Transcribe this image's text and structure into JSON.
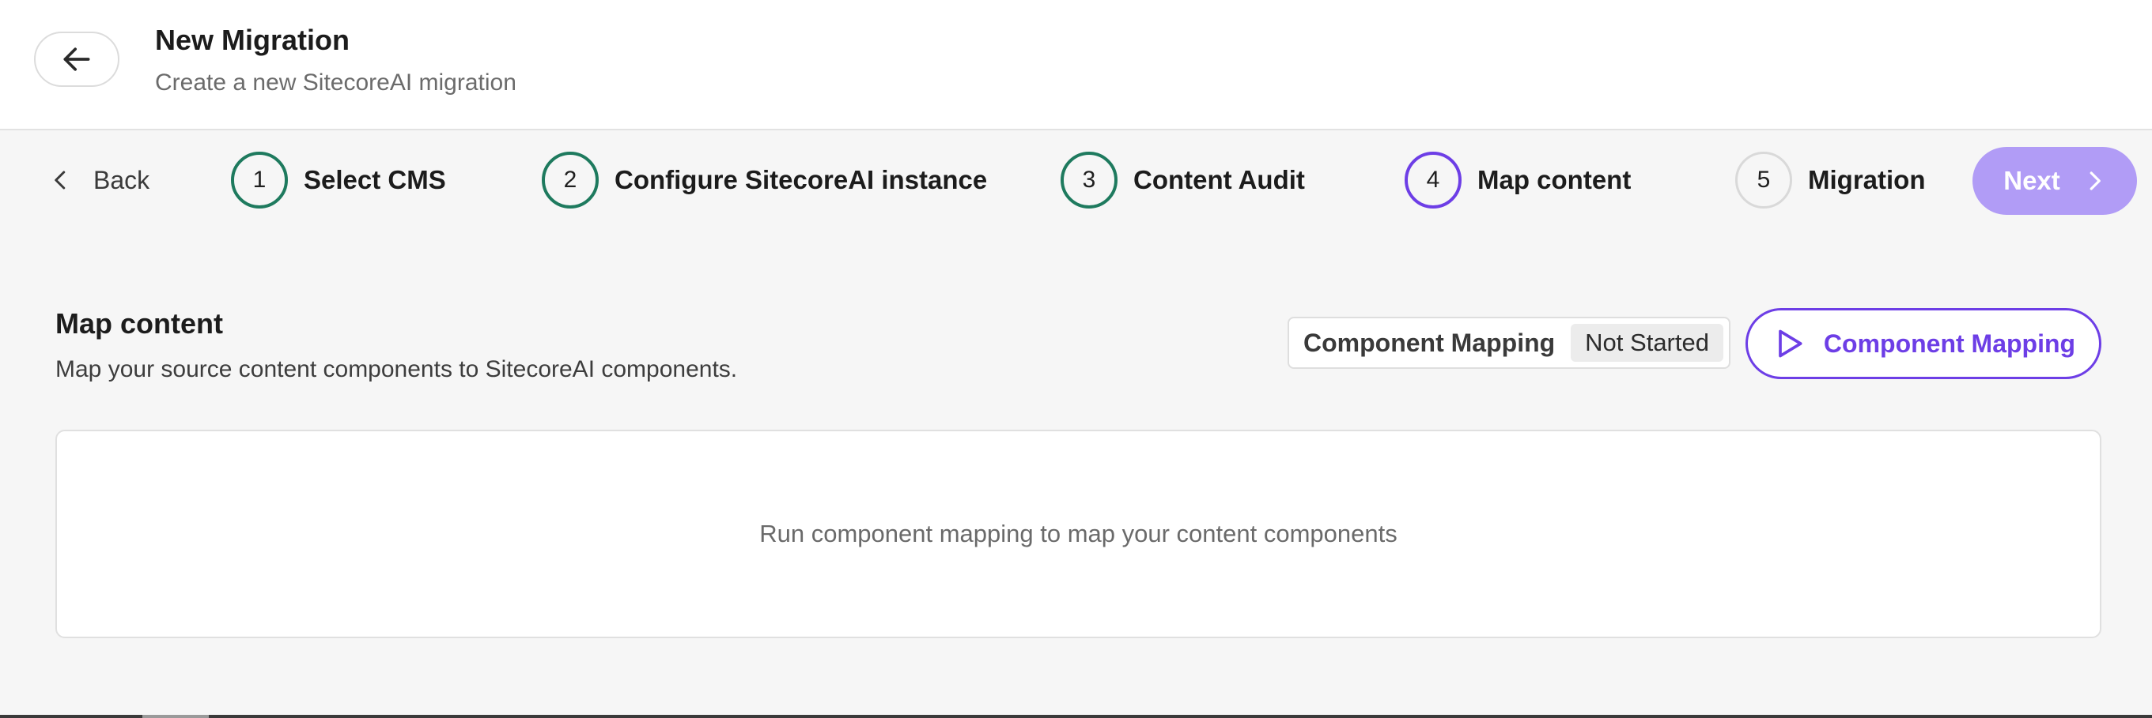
{
  "header": {
    "title": "New Migration",
    "subtitle": "Create a new SitecoreAI migration",
    "back_icon": "arrow-left-icon"
  },
  "stepper": {
    "back_label": "Back",
    "steps": [
      {
        "number": "1",
        "label": "Select CMS",
        "status": "completed"
      },
      {
        "number": "2",
        "label": "Configure SitecoreAI instance",
        "status": "completed"
      },
      {
        "number": "3",
        "label": "Content Audit",
        "status": "completed"
      },
      {
        "number": "4",
        "label": "Map content",
        "status": "current"
      },
      {
        "number": "5",
        "label": "Migration",
        "status": "pending"
      }
    ],
    "next_label": "Next"
  },
  "section": {
    "title": "Map content",
    "description": "Map your source content components to SitecoreAI components.",
    "status_label": "Component Mapping",
    "status_value": "Not Started",
    "run_button_label": "Component Mapping",
    "empty_message": "Run component mapping to map your content components"
  },
  "colors": {
    "completed": "#1e7a5e",
    "current": "#6d3ee6",
    "pending": "#d9d9d9",
    "primary": "#6d3ee6",
    "primary_disabled": "#b19cf6"
  }
}
